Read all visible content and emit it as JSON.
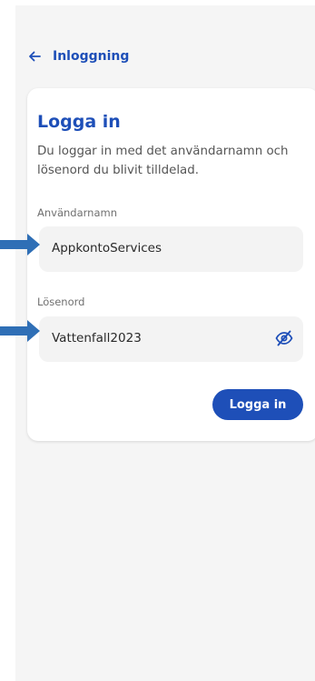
{
  "nav": {
    "back_label": "Inloggning"
  },
  "login_card": {
    "title": "Logga in",
    "description": "Du loggar in med det användarnamn och lösenord du blivit tilldelad.",
    "username_label": "Användarnamn",
    "username_value": "AppkontoServices",
    "password_label": "Lösenord",
    "password_value": "Vattenfall2023",
    "submit_label": "Logga in"
  },
  "icons": {
    "back": "arrow-left-icon",
    "password_toggle": "eye-off-icon",
    "annotations": "pointer-arrow-icon"
  },
  "colors": {
    "accent": "#1e4fb8",
    "annotation": "#2f6fb6",
    "field_bg": "#f3f3f3",
    "screen_bg": "#f5f5f5"
  }
}
